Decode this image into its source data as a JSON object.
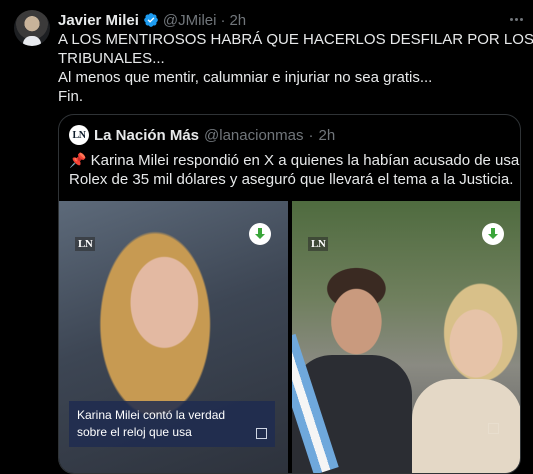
{
  "tweet": {
    "author_name": "Javier Milei",
    "handle": "@JMilei",
    "separator": "·",
    "time": "2h",
    "lines": [
      "A LOS MENTIROSOS HABRÁ QUE HACERLOS DESFILAR POR LOS",
      "TRIBUNALES...",
      "Al menos que mentir, calumniar e injuriar no sea gratis...",
      "Fin."
    ]
  },
  "quote": {
    "avatar_text": "LN",
    "author_name": "La Nación Más",
    "handle": "@lanacionmas",
    "separator": "·",
    "time": "2h",
    "pin_glyph": "📌",
    "lines": [
      "Karina Milei respondió en X a quienes la habían acusado de usar un",
      "Rolex de 35 mil dólares y aseguró que llevará el tema a la Justicia."
    ],
    "media": {
      "left": {
        "watermark": "LN",
        "caption_lines": [
          "Karina Milei contó la verdad",
          "sobre el reloj que usa"
        ]
      },
      "right": {
        "watermark": "LN"
      }
    }
  },
  "colors": {
    "background": "#000000",
    "text": "#e7e9ea",
    "muted": "#71767b",
    "verified": "#1d9bf0",
    "download_green": "#3aa53a"
  }
}
